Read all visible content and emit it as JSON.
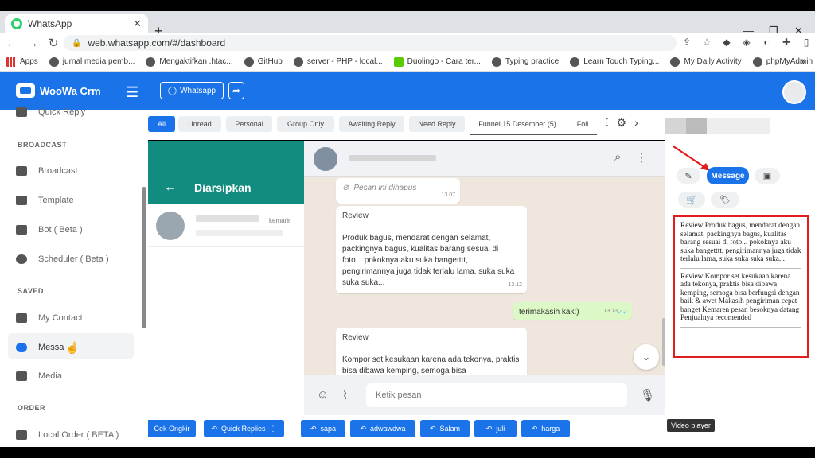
{
  "browser": {
    "tab_title": "WhatsApp",
    "tab_close": "✕",
    "new_tab": "+",
    "url": "web.whatsapp.com/#/dashboard",
    "bookmarks": [
      "Apps",
      "jurnal media pemb...",
      "Mengaktifkan .htac...",
      "GitHub",
      "server - PHP - local...",
      "Duolingo - Cara ter...",
      "Typing practice",
      "Learn Touch Typing...",
      "My Daily Activity",
      "phpMyAdmin"
    ],
    "bookmarks_more": "»"
  },
  "header": {
    "logo": "WooWa Crm",
    "whatsapp_button": "Whatsapp"
  },
  "sidebar": {
    "items": [
      {
        "label": "Quick Reply"
      },
      {
        "section": "BROADCAST"
      },
      {
        "label": "Broadcast"
      },
      {
        "label": "Template"
      },
      {
        "label": "Bot ( Beta )"
      },
      {
        "label": "Scheduler ( Beta )"
      },
      {
        "section": "SAVED"
      },
      {
        "label": "My Contact"
      },
      {
        "label": "Messa"
      },
      {
        "label": "Media"
      },
      {
        "section": "ORDER"
      },
      {
        "label": "Local Order ( BETA )"
      }
    ]
  },
  "filters": {
    "chips": [
      "All",
      "Unread",
      "Personal",
      "Group Only",
      "Awaiting Reply",
      "Need Reply",
      "Funnel 15 Desember (5)",
      "Foll"
    ],
    "active": "All"
  },
  "archived": {
    "title": "Diarsipkan",
    "back_icon": "←",
    "rows": [
      {
        "time": "kemarin"
      }
    ]
  },
  "chat": {
    "messages": [
      {
        "type": "deleted",
        "text": "Pesan ini dihapus",
        "time": "13.07"
      },
      {
        "type": "in",
        "label": "Review",
        "text": "Produk bagus, mendarat dengan selamat, packingnya bagus, kualitas barang sesuai di foto... pokoknya aku suka bangetttt, pengirimannya juga tidak terlalu lama, suka suka suka suka...",
        "time": "13.12"
      },
      {
        "type": "out",
        "text": "terimakasih kak:)",
        "time": "13.13"
      },
      {
        "type": "in",
        "label": "Review",
        "text": "Kompor set kesukaan karena ada tekonya, praktis bisa dibawa kemping, semoga bisa",
        "time": ""
      }
    ],
    "composer_placeholder": "Ketik pesan",
    "scroll_down_icon": "⌄"
  },
  "quick_replies": [
    "Cek Ongkir",
    "Quick Replies",
    "sapa",
    "adwawdwa",
    "Salam",
    "juli",
    "harga"
  ],
  "right_panel": {
    "message_button": "Message",
    "replies": [
      "Review Produk bagus, mendarat dengan selamat, packingnya bagus, kualitas barang sesuai di foto... pokoknya aku suka bangetttt, pengirimannya juga tidak terlalu lama, suka suka suka suka...",
      "Review Kompor set kesukaan karena ada tekonya, praktis bisa dibawa kemping, semoga bisa berfungsi dengan baik & awet Makasih pengiriman cepat banget Kemaren pesan besoknya datang Penjualnya recomended"
    ]
  },
  "tooltip": "Video player",
  "colors": {
    "primary": "#1a73e8",
    "whatsapp_green": "#128c7e",
    "highlight_red": "#e01c1c"
  }
}
